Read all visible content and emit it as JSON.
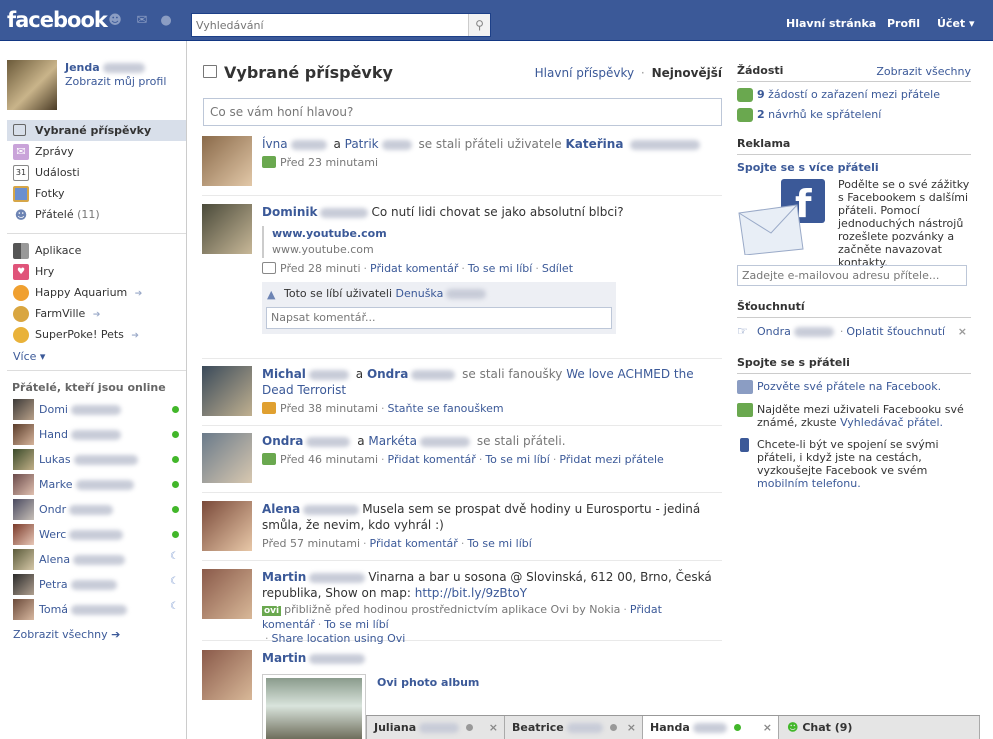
{
  "header": {
    "logo": "facebook",
    "search_placeholder": "Vyhledávání",
    "nav": [
      "Hlavní stránka",
      "Profil",
      "Účet ▾"
    ]
  },
  "profile": {
    "name": "Jenda",
    "link": "Zobrazit můj profil"
  },
  "sidebar": {
    "items": [
      {
        "label": "Vybrané příspěvky",
        "icon": "news-feed-icon",
        "selected": true
      },
      {
        "label": "Zprávy",
        "icon": "messages-icon"
      },
      {
        "label": "Události",
        "icon": "events-icon",
        "icon_text": "31"
      },
      {
        "label": "Fotky",
        "icon": "photos-icon"
      },
      {
        "label": "Přátelé",
        "icon": "friends-icon",
        "count": "(11)"
      }
    ],
    "apps": [
      {
        "label": "Aplikace",
        "icon": "apps-icon"
      },
      {
        "label": "Hry",
        "icon": "games-icon"
      },
      {
        "label": "Happy Aquarium",
        "icon": "aquarium-icon",
        "arrow": "➔"
      },
      {
        "label": "FarmVille",
        "icon": "farmville-icon",
        "arrow": "➔"
      },
      {
        "label": "SuperPoke! Pets",
        "icon": "superpoke-icon",
        "arrow": "➔"
      }
    ],
    "more": "Více ▾",
    "online_title": "Přátelé, kteří jsou online",
    "friends": [
      {
        "name": "Domi",
        "status": "online"
      },
      {
        "name": "Hand",
        "status": "online"
      },
      {
        "name": "Lukas",
        "status": "online"
      },
      {
        "name": "Marke",
        "status": "online"
      },
      {
        "name": "Ondr",
        "status": "online"
      },
      {
        "name": "Werc",
        "status": "online"
      },
      {
        "name": "Alena",
        "status": "idle"
      },
      {
        "name": "Petra",
        "status": "idle"
      },
      {
        "name": "Tomá",
        "status": "idle"
      }
    ],
    "see_all": "Zobrazit všechny ➔"
  },
  "feed": {
    "title": "Vybrané příspěvky",
    "filter_top": "Hlavní příspěvky",
    "filter_sep": "·",
    "filter_new": "Nejnovější",
    "status_placeholder": "Co se vám honí hlavou?",
    "stories": [
      {
        "actor": "Ívna",
        "and": "a",
        "actor2": "Patrik",
        "text": "se stali přáteli uživatele",
        "target": "Kateřina",
        "meta": "Před 23 minutami"
      },
      {
        "actor": "Dominik",
        "text": "Co nutí lidi chovat se jako absolutní blbci?",
        "attach_title": "www.youtube.com",
        "attach_url": "www.youtube.com",
        "meta": "Před 28 minuti",
        "comment": "Přidat komentář",
        "like": "To se mi líbí",
        "share": "Sdílet",
        "likes_text": "Toto se líbí uživateli",
        "likes_name": "Denuška",
        "comment_placeholder": "Napsat komentář..."
      },
      {
        "actor": "Michal",
        "and": "a",
        "actor2": "Ondra",
        "text": "se stali fanoušky",
        "target": "We love ACHMED the Dead Terrorist",
        "meta": "Před 38 minutami",
        "fan": "Staňte se fanouškem"
      },
      {
        "actor": "Ondra",
        "and": "a",
        "actor2": "Markéta",
        "text": "se stali přáteli.",
        "meta": "Před 46 minutami",
        "comment": "Přidat komentář",
        "like": "To se mi líbí",
        "add": "Přidat mezi přátele"
      },
      {
        "actor": "Alena",
        "text": "Musela sem se prospat dvě hodiny u Eurosportu - jediná smůla, že nevim, kdo vyhrál :)",
        "meta": "Před 57 minutami",
        "comment": "Přidat komentář",
        "like": "To se mi líbí"
      },
      {
        "actor": "Martin",
        "text": "Vinarna a bar u sosona @ Slovinská, 612 00, Brno, Česká republika, Show on map:",
        "link": "http://bit.ly/9zBtoY",
        "ovi": "ovi",
        "meta": "přibližně před hodinou prostřednictvím aplikace Ovi by Nokia",
        "comment": "Přidat komentář",
        "like": "To se mi líbí",
        "extra": "Share location using Ovi"
      },
      {
        "actor": "Martin",
        "album": "Ovi photo album"
      }
    ]
  },
  "right": {
    "requests_title": "Žádosti",
    "requests_all": "Zobrazit všechny",
    "req1_num": "9",
    "req1": "žádostí o zařazení mezi přátele",
    "req2_num": "2",
    "req2": "návrhů ke spřátelení",
    "ad_section": "Reklama",
    "ad_title": "Spojte se s více přáteli",
    "ad_text": "Podělte se o své zážitky s Facebookem s dalšími přáteli. Pomocí jednoduchých nástrojů rozešlete pozvánky a začněte navazovat kontakty.",
    "email_placeholder": "Zadejte e-mailovou adresu přítele...",
    "poke_title": "Šťouchnutí",
    "poke_name": "Ondra",
    "poke_back": "Oplatit šťouchnutí",
    "close": "×",
    "connect_title": "Spojte se s přáteli",
    "c1": "Pozvěte své přátele na Facebook.",
    "c2a": "Najděte mezi uživateli Facebooku své známé, zkuste",
    "c2b": "Vyhledávač přátel.",
    "c3a": "Chcete-li být ve spojení se svými přáteli, i když jste na cestách, vyzkoušejte Facebook ve svém",
    "c3b": "mobilním telefonu."
  },
  "chat": {
    "tabs": [
      {
        "name": "Juliana",
        "status": "idle"
      },
      {
        "name": "Beatrice",
        "status": "idle"
      },
      {
        "name": "Handa",
        "status": "online"
      }
    ],
    "close": "×",
    "main": "Chat (9)"
  },
  "colors": {
    "brand": "#3b5998",
    "online": "#42b72a",
    "selected": "#d8dfea"
  }
}
